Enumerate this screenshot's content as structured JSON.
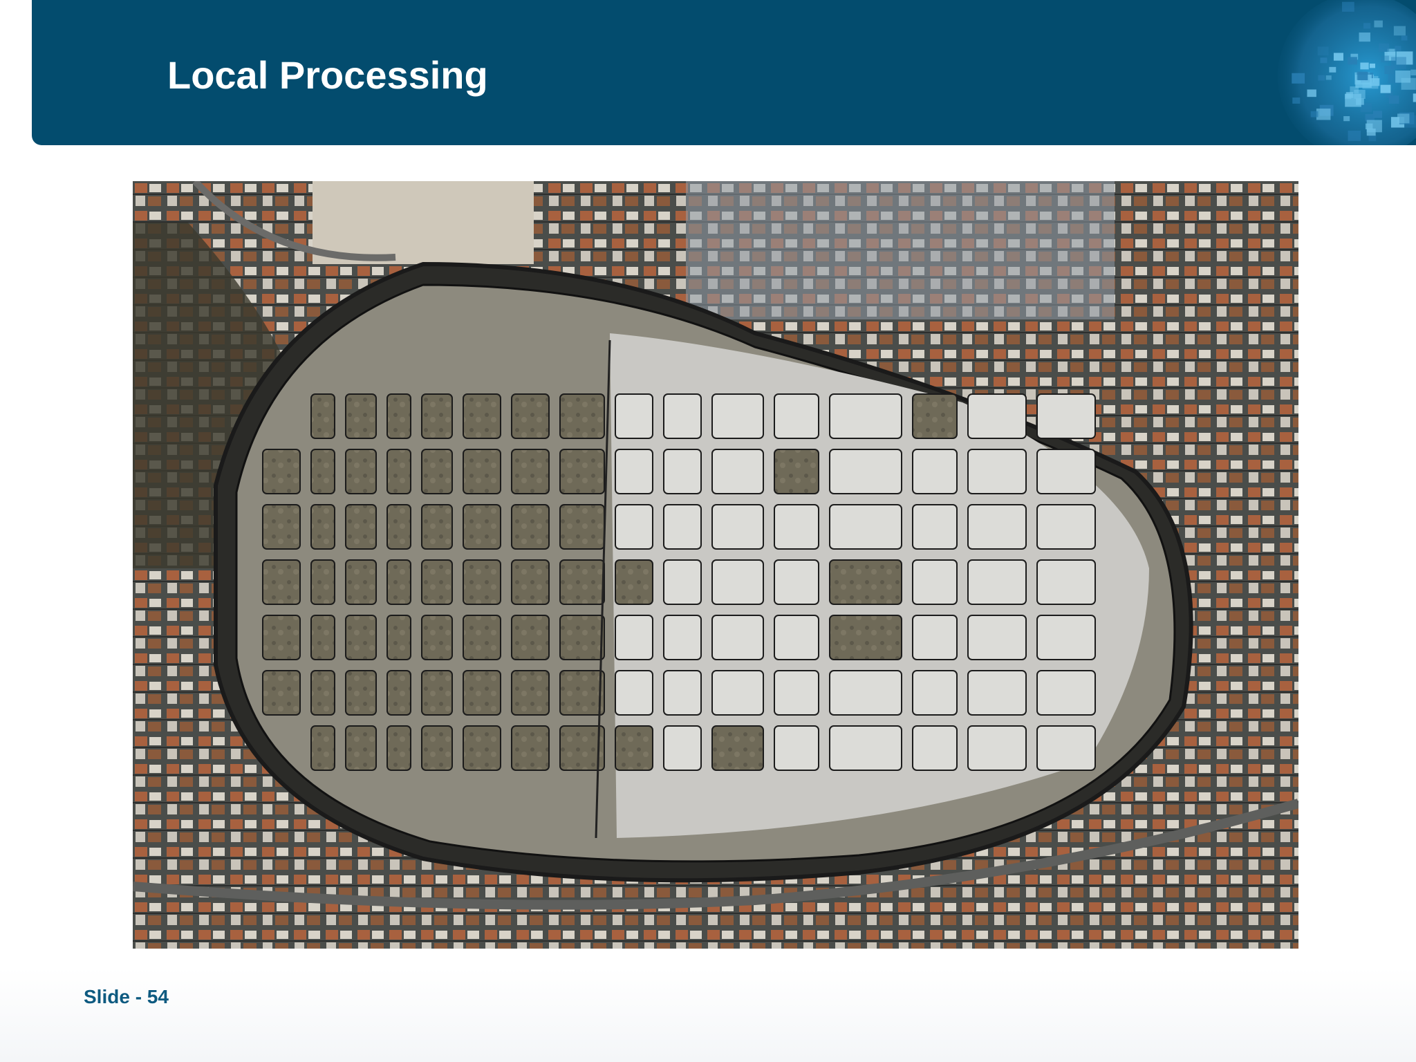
{
  "slide": {
    "title": "Local Processing",
    "footer": "Slide - 54"
  },
  "colors": {
    "header": "#034c6e",
    "footer_text": "#0d5a80",
    "globe_accent": "#2a9fd8"
  },
  "icons": {
    "brand": "globe-mosaic-icon"
  },
  "image": {
    "subject": "aerial-photo-segmentation"
  }
}
